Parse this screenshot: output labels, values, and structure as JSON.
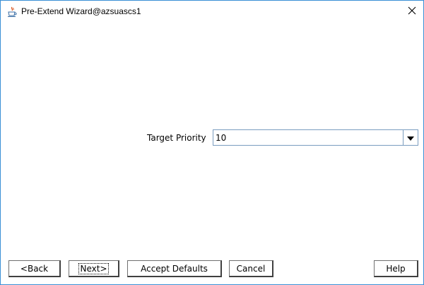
{
  "window": {
    "title": "Pre-Extend Wizard@azsuascs1",
    "icon": "java-cup-icon",
    "close_icon": "close-x-icon"
  },
  "form": {
    "target_priority": {
      "label": "Target Priority",
      "value": "10"
    }
  },
  "buttons": {
    "back": "<Back",
    "next": "Next>",
    "accept_defaults": "Accept Defaults",
    "cancel": "Cancel",
    "help": "Help"
  },
  "colors": {
    "window_border": "#3a8fd6",
    "field_border": "#7a9cbf"
  }
}
